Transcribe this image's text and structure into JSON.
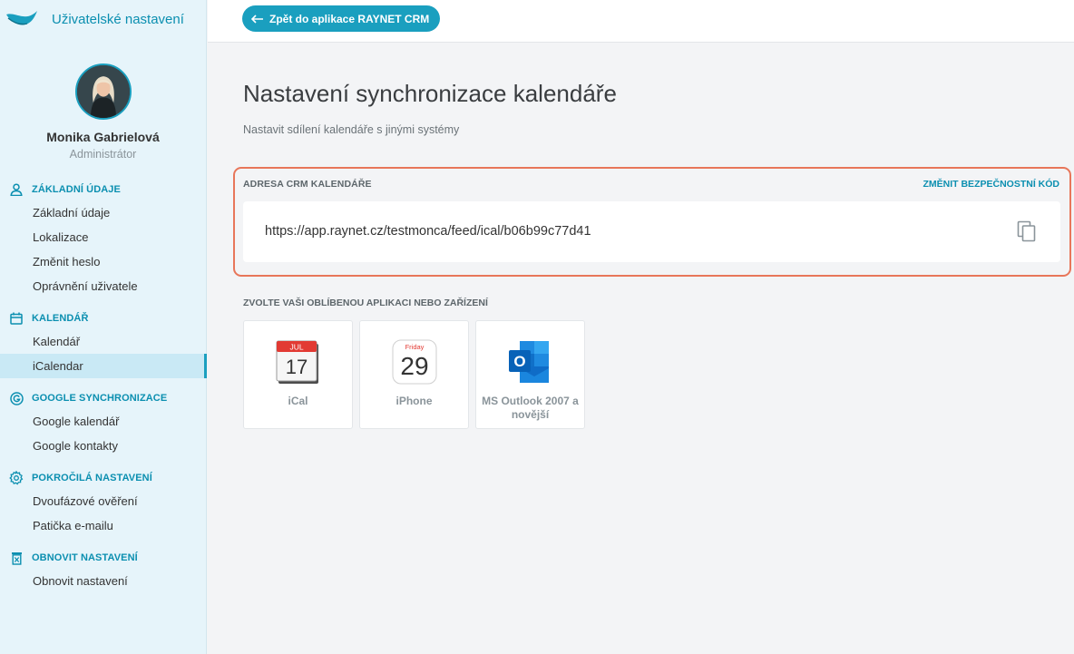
{
  "app": {
    "title": "Uživatelské nastavení"
  },
  "user": {
    "name": "Monika Gabrielová",
    "role": "Administrátor"
  },
  "nav": [
    {
      "icon": "person-icon",
      "label": "Základní údaje",
      "items": [
        "Základní údaje",
        "Lokalizace",
        "Změnit heslo",
        "Oprávnění uživatele"
      ]
    },
    {
      "icon": "calendar-icon",
      "label": "Kalendář",
      "items": [
        "Kalendář",
        "iCalendar"
      ]
    },
    {
      "icon": "google-icon",
      "label": "Google synchronizace",
      "items": [
        "Google kalendář",
        "Google kontakty"
      ]
    },
    {
      "icon": "gear-icon",
      "label": "Pokročilá nastavení",
      "items": [
        "Dvoufázové ověření",
        "Patička e-mailu"
      ]
    },
    {
      "icon": "trash-icon",
      "label": "Obnovit nastavení",
      "items": [
        "Obnovit nastavení"
      ]
    }
  ],
  "active_item": "iCalendar",
  "topbar": {
    "back_label": "Zpět do aplikace RAYNET CRM"
  },
  "page": {
    "title": "Nastavení synchronizace kalendáře",
    "subtitle": "Nastavit sdílení kalendáře s jinými systémy"
  },
  "ics": {
    "label": "Adresa CRM kalendáře",
    "change_link": "Změnit bezpečnostní kód",
    "url": "https://app.raynet.cz/testmonca/feed/ical/b06b99c77d41"
  },
  "apps": {
    "label": "Zvolte vaši oblíbenou aplikaci nebo zařízení",
    "items": [
      {
        "name": "iCal",
        "icon": "ical-icon",
        "month": "JUL",
        "day": "17"
      },
      {
        "name": "iPhone",
        "icon": "iphone-calendar-icon",
        "weekday": "Friday",
        "day": "29"
      },
      {
        "name": "MS Outlook 2007 a novější",
        "icon": "outlook-icon",
        "letter": "O"
      }
    ]
  },
  "colors": {
    "accent": "#1a9fbf",
    "highlight_border": "#e8765a",
    "sidebar_bg": "#e6f4fa"
  }
}
